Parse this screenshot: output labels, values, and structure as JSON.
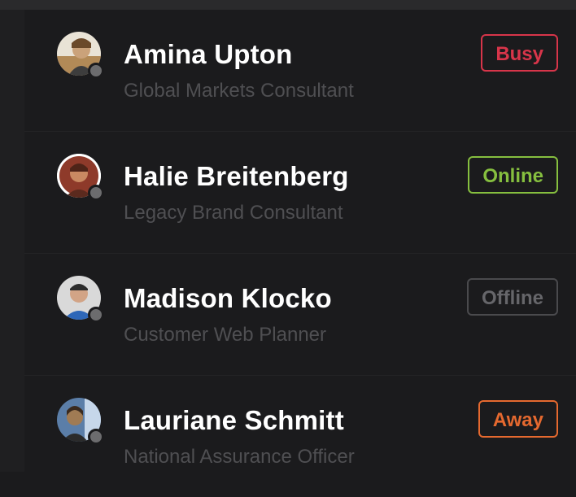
{
  "contacts": [
    {
      "name": "Amina Upton",
      "role": "Global Markets Consultant",
      "status": "Busy",
      "status_color": "#d8354a",
      "avatar": "avatar-photo-1"
    },
    {
      "name": "Halie Breitenberg",
      "role": "Legacy Brand Consultant",
      "status": "Online",
      "status_color": "#86bf3f",
      "avatar": "avatar-photo-2"
    },
    {
      "name": "Madison Klocko",
      "role": "Customer Web Planner",
      "status": "Offline",
      "status_color": "#66666a",
      "avatar": "avatar-photo-3"
    },
    {
      "name": "Lauriane Schmitt",
      "role": "National Assurance Officer",
      "status": "Away",
      "status_color": "#e5692f",
      "avatar": "avatar-photo-4"
    }
  ]
}
